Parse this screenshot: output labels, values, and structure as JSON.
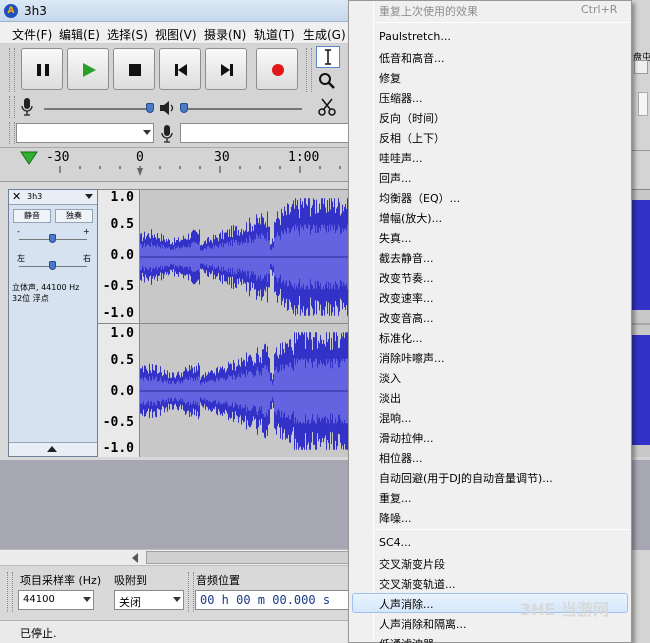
{
  "window": {
    "title": "3h3",
    "logo_text": "A"
  },
  "menubar": [
    {
      "id": "file",
      "label": "文件(F)"
    },
    {
      "id": "edit",
      "label": "编辑(E)"
    },
    {
      "id": "select",
      "label": "选择(S)"
    },
    {
      "id": "view",
      "label": "视图(V)"
    },
    {
      "id": "record",
      "label": "摄录(N)"
    },
    {
      "id": "tracks",
      "label": "轨道(T)"
    },
    {
      "id": "generate",
      "label": "生成(G)"
    }
  ],
  "ruler": {
    "ticks": [
      "-30",
      "0",
      "30",
      "1:00"
    ]
  },
  "track": {
    "name": "3h3",
    "mute_label": "静音",
    "solo_label": "独奏",
    "gain_minus": "-",
    "gain_plus": "+",
    "pan_left": "左",
    "pan_right": "右",
    "info_line1": "立体声, 44100 Hz",
    "info_line2": "32位 浮点",
    "scale": [
      "1.0",
      "0.5",
      "0.0",
      "-0.5",
      "-1.0"
    ]
  },
  "selection_bar": {
    "rate_label": "项目采样率 (Hz)",
    "rate_value": "44100",
    "snap_label": "吸附到",
    "snap_value": "关闭",
    "pos_label": "音频位置",
    "pos_value": "00 h 00 m 00.000 s"
  },
  "status": {
    "text": "已停止."
  },
  "right_strip": {
    "partial_text": "盘屯"
  },
  "context_menu": {
    "header": {
      "label": "重复上次使用的效果",
      "shortcut": "Ctrl+R"
    },
    "group1": [
      "Paulstretch...",
      "低音和高音...",
      "修复",
      "压缩器...",
      "反向（时间）",
      "反相（上下）",
      "哇哇声...",
      "回声...",
      "均衡器（EQ）...",
      "增幅(放大)...",
      "失真...",
      "截去静音...",
      "改变节奏...",
      "改变速率...",
      "改变音高...",
      "标准化...",
      "消除咔嚓声...",
      "淡入",
      "淡出",
      "混响...",
      "滑动拉伸...",
      "相位器...",
      "自动回避(用于DJ的自动音量调节)...",
      "重复...",
      "降噪..."
    ],
    "group2": [
      "SC4...",
      "交叉渐变片段",
      "交叉渐变轨道...",
      "人声消除...",
      "人声消除和隔离...",
      "低通滤波器..."
    ],
    "highlighted_index": 3
  },
  "watermark": {
    "text": "3HE 当游网"
  },
  "colors": {
    "waveform": "#3232c8",
    "wave_bg": "#c8c8c8",
    "menu_highlight": "#d5e7fb"
  }
}
